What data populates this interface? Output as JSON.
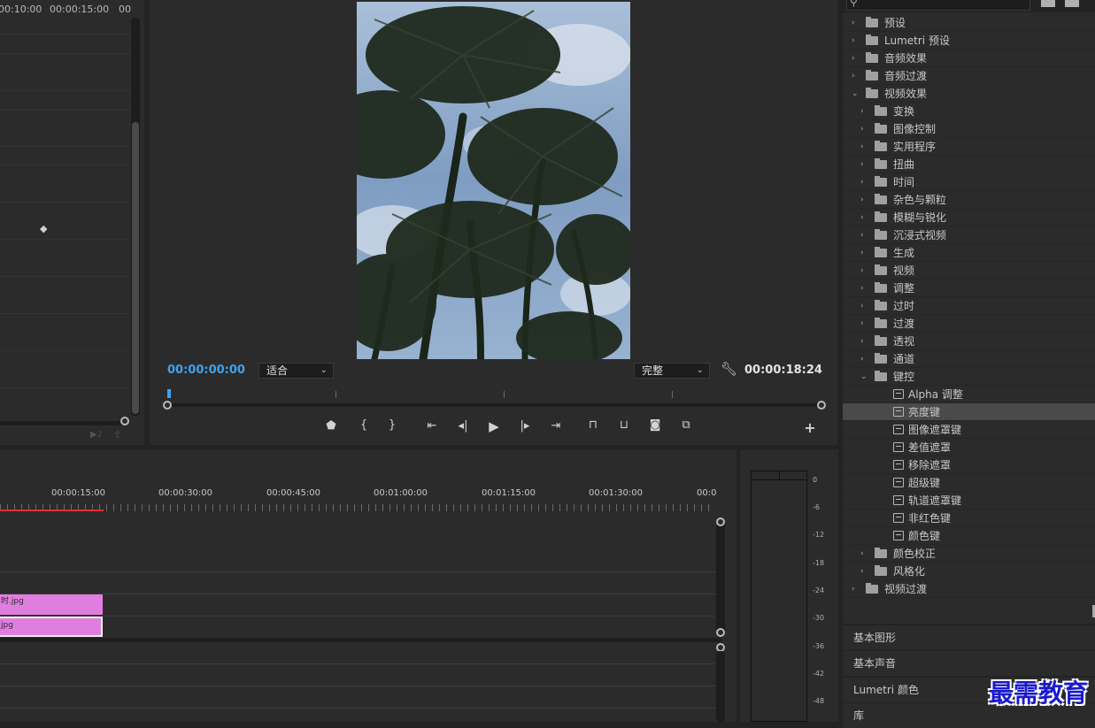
{
  "effect_controls": {
    "ruler_times": [
      "00:10:00",
      "00:00:15:00",
      "00"
    ]
  },
  "program_monitor": {
    "current_timecode": "00:00:00:00",
    "fit_dropdown": "适合",
    "quality_dropdown": "完整",
    "duration_timecode": "00:00:18:24",
    "transport_icons": [
      "marker-icon",
      "mark-in-icon",
      "mark-out-icon",
      "go-to-in-icon",
      "step-back-icon",
      "play-icon",
      "step-forward-icon",
      "go-to-out-icon",
      "lift-icon",
      "extract-icon",
      "camera-icon",
      "compare-icon",
      "add-button-icon"
    ]
  },
  "timeline": {
    "ruler_labels": [
      "00:00:15:00",
      "00:00:30:00",
      "00:00:45:00",
      "00:01:00:00",
      "00:01:15:00",
      "00:01:30:00",
      "00:0"
    ],
    "clips": [
      {
        "name": "时.jpg"
      },
      {
        "name": "jpg"
      }
    ],
    "playhead_color": "#e03030"
  },
  "audio_meter": {
    "db_labels": [
      "0",
      "-6",
      "-12",
      "-18",
      "-24",
      "-30",
      "-36",
      "-42",
      "-48"
    ]
  },
  "effects": {
    "items": [
      {
        "label": "预设",
        "level": 0,
        "icon": "folder-star",
        "expanded": false
      },
      {
        "label": "Lumetri 预设",
        "level": 0,
        "icon": "folder-star",
        "expanded": false
      },
      {
        "label": "音频效果",
        "level": 0,
        "icon": "folder",
        "expanded": false
      },
      {
        "label": "音频过渡",
        "level": 0,
        "icon": "folder",
        "expanded": false
      },
      {
        "label": "视频效果",
        "level": 0,
        "icon": "folder",
        "expanded": true
      },
      {
        "label": "变换",
        "level": 1,
        "icon": "folder",
        "expanded": false
      },
      {
        "label": "图像控制",
        "level": 1,
        "icon": "folder",
        "expanded": false
      },
      {
        "label": "实用程序",
        "level": 1,
        "icon": "folder",
        "expanded": false
      },
      {
        "label": "扭曲",
        "level": 1,
        "icon": "folder",
        "expanded": false
      },
      {
        "label": "时间",
        "level": 1,
        "icon": "folder",
        "expanded": false
      },
      {
        "label": "杂色与颗粒",
        "level": 1,
        "icon": "folder",
        "expanded": false
      },
      {
        "label": "模糊与锐化",
        "level": 1,
        "icon": "folder",
        "expanded": false
      },
      {
        "label": "沉浸式视频",
        "level": 1,
        "icon": "folder",
        "expanded": false
      },
      {
        "label": "生成",
        "level": 1,
        "icon": "folder",
        "expanded": false
      },
      {
        "label": "视频",
        "level": 1,
        "icon": "folder",
        "expanded": false
      },
      {
        "label": "调整",
        "level": 1,
        "icon": "folder",
        "expanded": false
      },
      {
        "label": "过时",
        "level": 1,
        "icon": "folder",
        "expanded": false
      },
      {
        "label": "过渡",
        "level": 1,
        "icon": "folder",
        "expanded": false
      },
      {
        "label": "透视",
        "level": 1,
        "icon": "folder",
        "expanded": false
      },
      {
        "label": "通道",
        "level": 1,
        "icon": "folder",
        "expanded": false
      },
      {
        "label": "键控",
        "level": 1,
        "icon": "folder",
        "expanded": true
      },
      {
        "label": "Alpha 调整",
        "level": 2,
        "icon": "effect",
        "selected": false
      },
      {
        "label": "亮度键",
        "level": 2,
        "icon": "effect",
        "selected": true
      },
      {
        "label": "图像遮罩键",
        "level": 2,
        "icon": "effect",
        "selected": false
      },
      {
        "label": "差值遮罩",
        "level": 2,
        "icon": "effect",
        "selected": false
      },
      {
        "label": "移除遮罩",
        "level": 2,
        "icon": "effect",
        "selected": false
      },
      {
        "label": "超级键",
        "level": 2,
        "icon": "effect",
        "selected": false
      },
      {
        "label": "轨道遮罩键",
        "level": 2,
        "icon": "effect",
        "selected": false
      },
      {
        "label": "非红色键",
        "level": 2,
        "icon": "effect",
        "selected": false
      },
      {
        "label": "颜色键",
        "level": 2,
        "icon": "effect",
        "selected": false
      },
      {
        "label": "颜色校正",
        "level": 1,
        "icon": "folder",
        "expanded": false
      },
      {
        "label": "风格化",
        "level": 1,
        "icon": "folder",
        "expanded": false
      },
      {
        "label": "视频过渡",
        "level": 0,
        "icon": "folder",
        "expanded": false
      }
    ]
  },
  "bottom_panels": [
    "基本图形",
    "基本声音",
    "Lumetri 颜色",
    "库"
  ],
  "watermark": "最需教育"
}
